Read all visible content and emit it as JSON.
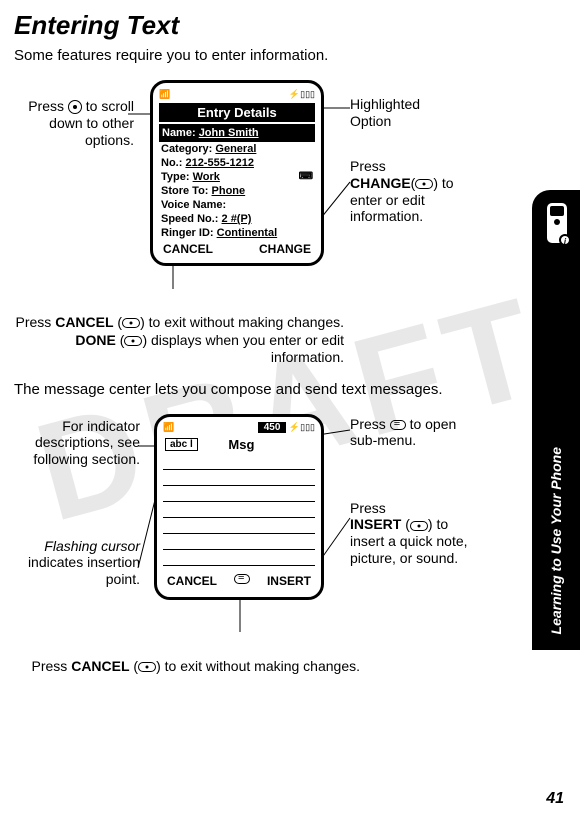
{
  "watermark": "DRAFT",
  "title": "Entering Text",
  "intro": "Some features require you to enter information.",
  "fig1": {
    "screen_title": "Entry Details",
    "name_label": "Name:",
    "name_value": "John Smith",
    "category_label": "Category:",
    "category_value": "General",
    "no_label": "No.:",
    "no_value": "212-555-1212",
    "type_label": "Type:",
    "type_value": "Work",
    "storeto_label": "Store To:",
    "storeto_value": "Phone",
    "voice_label": "Voice Name:",
    "speed_label": "Speed No.:",
    "speed_value": "2 #(P)",
    "ringer_label": "Ringer ID:",
    "ringer_value": "Continental",
    "soft_left": "CANCEL",
    "soft_right": "CHANGE",
    "callout_left": "Press      to scroll down to other options.",
    "callout_left_pre": "Press ",
    "callout_left_post": " to scroll down to other options.",
    "callout_right1": "Highlighted Option",
    "callout_right2a": "Press",
    "callout_right2b": "CHANGE",
    "callout_right2c": "(",
    "callout_right2d": ") to enter or edit information.",
    "caption_a": "Press ",
    "caption_cancel": "CANCEL",
    "caption_b": " (",
    "caption_c": ") to exit without making changes. ",
    "caption_done": "DONE",
    "caption_d": " (",
    "caption_e": ") displays when you enter or edit information."
  },
  "mid": "The message center lets you compose and send text messages.",
  "fig2": {
    "mode": "abc l",
    "counter": "450",
    "msg_title": "Msg",
    "soft_left": "CANCEL",
    "soft_right": "INSERT",
    "callout_l1": "For indicator descriptions, see following section.",
    "callout_l2a": "Flashing cursor",
    "callout_l2b": " indicates insertion point.",
    "callout_r1a": "Press ",
    "callout_r1b": " to open sub-menu.",
    "callout_r2a": "Press",
    "callout_r2b": "INSERT",
    "callout_r2c": " (",
    "callout_r2d": ") to insert a quick note, picture, or sound.",
    "caption2_a": "Press ",
    "caption2_cancel": "CANCEL",
    "caption2_b": " (",
    "caption2_c": ") to exit without making changes."
  },
  "sidetab": "Learning to Use Your Phone",
  "pagenum": "41"
}
